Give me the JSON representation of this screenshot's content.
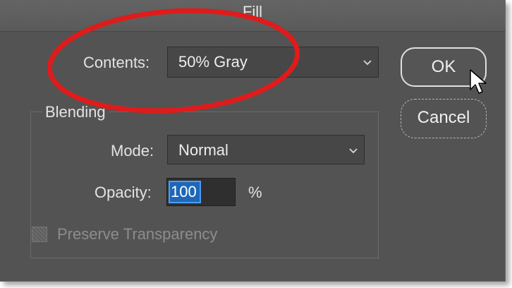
{
  "window": {
    "title": "Fill"
  },
  "contents": {
    "label": "Contents:",
    "value": "50% Gray"
  },
  "blending": {
    "group_label": "Blending",
    "mode_label": "Mode:",
    "mode_value": "Normal",
    "opacity_label": "Opacity:",
    "opacity_value": "100",
    "opacity_unit": "%",
    "preserve_label": "Preserve Transparency",
    "preserve_checked": false
  },
  "buttons": {
    "ok": "OK",
    "cancel": "Cancel"
  },
  "colors": {
    "dialog_bg": "#535353",
    "annotation": "#e01b1b",
    "selection": "#1e66b8"
  },
  "icons": [
    "chevron-down-icon",
    "mouse-pointer-icon"
  ]
}
